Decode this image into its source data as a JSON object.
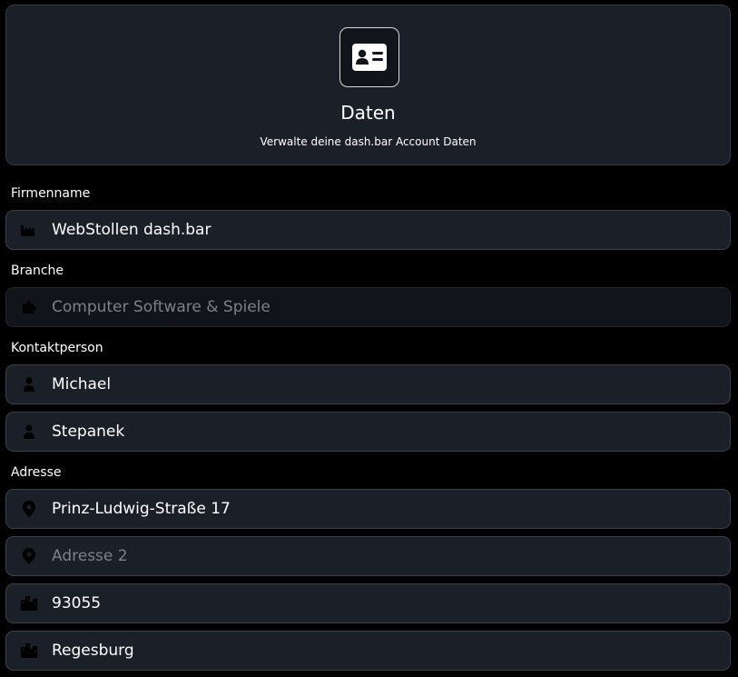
{
  "header": {
    "icon": "id-card-icon",
    "title": "Daten",
    "subtitle": "Verwalte deine dash.bar Account Daten"
  },
  "sections": {
    "company_label": "Firmenname",
    "industry_label": "Branche",
    "contact_label": "Kontaktperson",
    "address_label": "Adresse"
  },
  "fields": {
    "company": {
      "value": "WebStollen dash.bar",
      "placeholder": "",
      "icon": "factory-icon"
    },
    "industry": {
      "value": "Computer Software & Spiele",
      "placeholder": "",
      "icon": "puzzle-icon",
      "disabled": true
    },
    "first_name": {
      "value": "Michael",
      "placeholder": "",
      "icon": "person-icon"
    },
    "last_name": {
      "value": "Stepanek",
      "placeholder": "",
      "icon": "person-icon"
    },
    "address1": {
      "value": "Prinz-Ludwig-Straße 17",
      "placeholder": "",
      "icon": "map-pin-icon"
    },
    "address2": {
      "value": "",
      "placeholder": "Adresse 2",
      "icon": "map-pin-icon"
    },
    "zip": {
      "value": "93055",
      "placeholder": "",
      "icon": "city-icon"
    },
    "city": {
      "value": "Regesburg",
      "placeholder": "",
      "icon": "city-icon"
    }
  }
}
